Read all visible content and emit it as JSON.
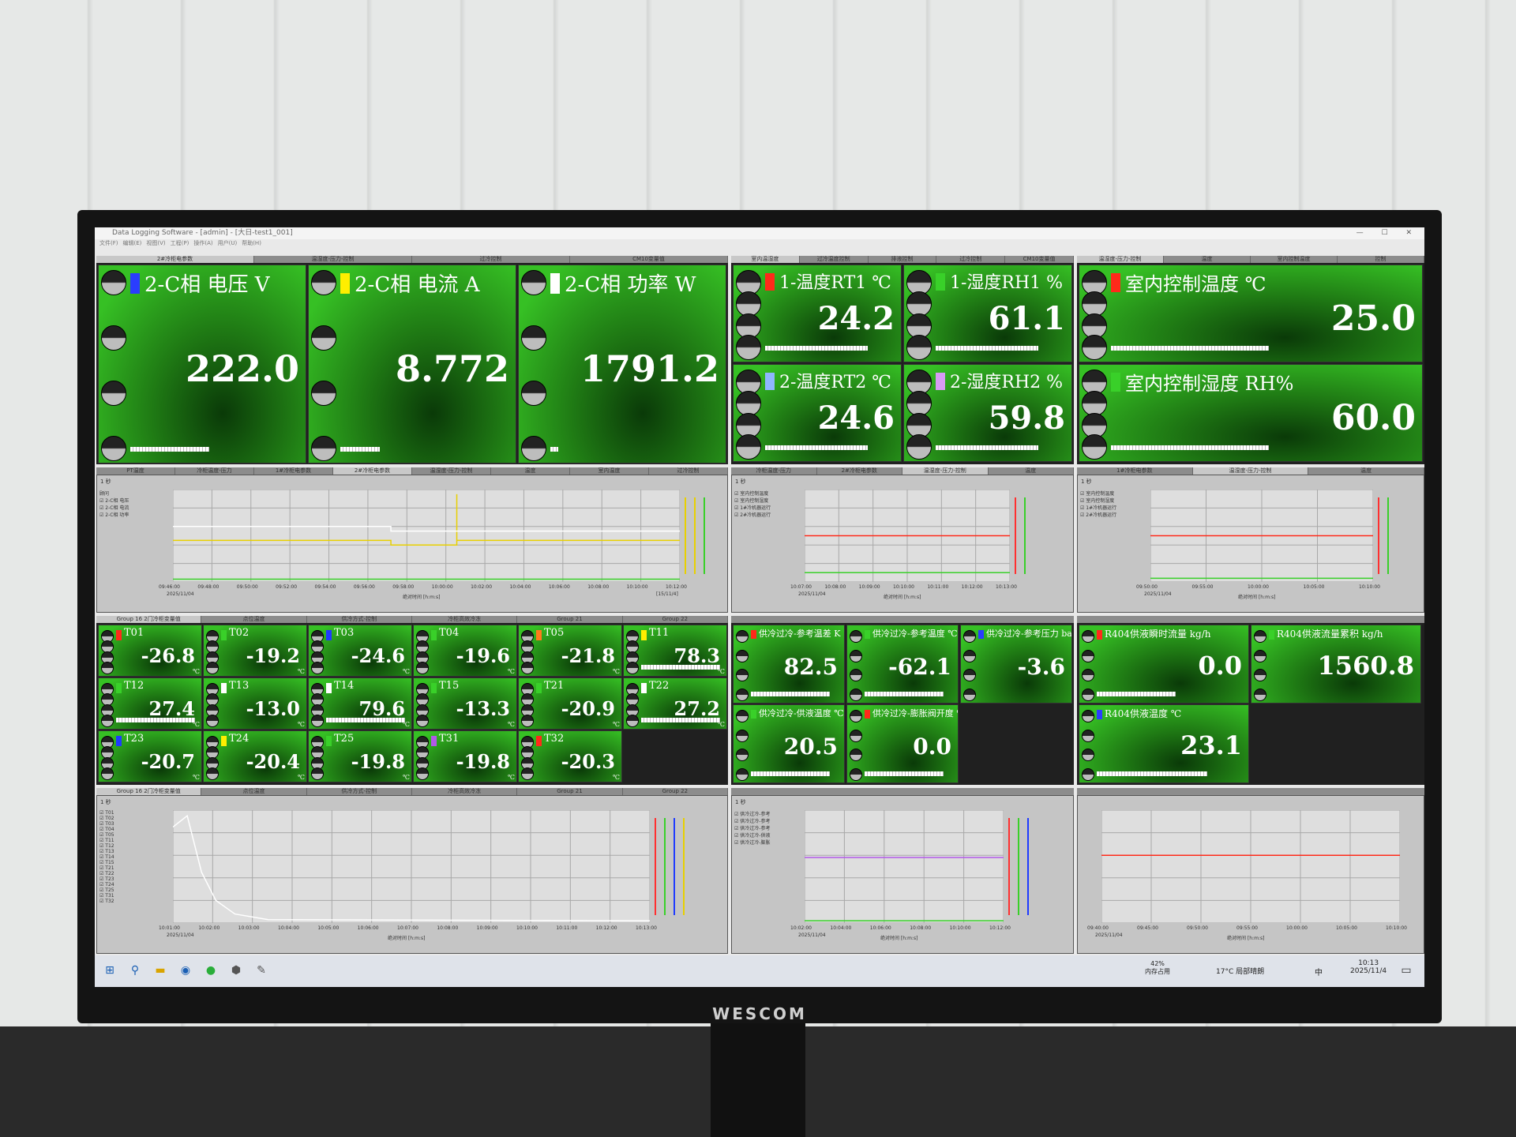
{
  "window": {
    "title": "Data Logging Software - [admin] - [大日-test1_001]",
    "controls": "— ☐ ✕",
    "menu": [
      "文件(F)",
      "编辑(E)",
      "视图(V)",
      "工程(P)",
      "操作(A)",
      "用户(U)",
      "帮助(H)"
    ]
  },
  "top_left_tabs": [
    "2#冷柜电参数",
    "温湿度-压力-控制",
    "过冷控制",
    "CM10变量值"
  ],
  "top_mid_tabs": [
    "室内温湿度",
    "过冷温度控制",
    "排液控制",
    "过冷控制",
    "CM10变量值"
  ],
  "top_right_tabs": [
    "温湿度-压力-控制",
    "温度",
    "室内控制温度",
    "控制"
  ],
  "power_tiles": [
    {
      "label": "2-C相  电压 V",
      "value": "222.0",
      "color": "#2a3dff"
    },
    {
      "label": "2-C相  电流 A",
      "value": "8.772",
      "color": "#ffee00"
    },
    {
      "label": "2-C相  功率 W",
      "value": "1791.2",
      "color": "#ffffff"
    }
  ],
  "env_tiles": [
    {
      "label": "1-温度RT1 ℃",
      "value": "24.2",
      "color": "#ff2a1a"
    },
    {
      "label": "1-湿度RH1  %",
      "value": "61.1",
      "color": "#39d029"
    },
    {
      "label": "2-温度RT2 ℃",
      "value": "24.6",
      "color": "#8fb6ff"
    },
    {
      "label": "2-湿度RH2  %",
      "value": "59.8",
      "color": "#d79bf2"
    }
  ],
  "room_tiles": [
    {
      "label": "室内控制温度 ℃",
      "value": "25.0",
      "color": "#ff2a1a"
    },
    {
      "label": "室内控制湿度 RH%",
      "value": "60.0",
      "color": "#39d029"
    }
  ],
  "chart_tabs_1": [
    "PT温度",
    "冷柜温度-压力",
    "1#冷柜电参数",
    "2#冷柜电参数",
    "温湿度-压力-控制",
    "温度",
    "室内温度",
    "过冷控制"
  ],
  "chart_tabs_2": [
    "冷柜温度-压力",
    "2#冷柜电参数",
    "温湿度-压力-控制",
    "温度"
  ],
  "chart_tabs_3": [
    "1#冷柜电参数",
    "温湿度-压力-控制",
    "温度"
  ],
  "chart1": {
    "interval": "1 秒",
    "legend_header": "顾问",
    "legend": [
      "2-C相  电压",
      "2-C相  电流",
      "2-C相  功率"
    ],
    "x_ticks": [
      "09:46:00",
      "09:48:00",
      "09:50:00",
      "09:52:00",
      "09:54:00",
      "09:56:00",
      "09:58:00",
      "10:00:00",
      "10:02:00",
      "10:04:00",
      "10:06:00",
      "10:08:00",
      "10:10:00",
      "10:12:00"
    ],
    "date": "2025/11/04",
    "xlabel": "绝对时间 [h:m:s]",
    "end_date": "[15/11/4]"
  },
  "chart2": {
    "interval": "1 秒",
    "legend": [
      "室内控制温度",
      "室内控制湿度",
      "1#冷机器运行",
      "2#冷机器运行"
    ],
    "x_ticks": [
      "10:07:00",
      "10:08:00",
      "10:09:00",
      "10:10:00",
      "10:11:00",
      "10:12:00",
      "10:13:00"
    ],
    "date": "2025/11/04",
    "xlabel": "绝对时间 [h:m:s]"
  },
  "chart3": {
    "interval": "1 秒",
    "legend": [
      "室内控制温度",
      "室内控制湿度",
      "1#冷机器运行",
      "2#冷机器运行"
    ],
    "x_ticks": [
      "09:50:00",
      "09:55:00",
      "10:00:00",
      "10:05:00",
      "10:10:00"
    ],
    "date": "2025/11/04",
    "xlabel": "绝对时间 [h:m:s]"
  },
  "group_tabs": [
    "Group 16 2门冷柜变量值",
    "点位温度",
    "供冷方式-控制",
    "冷柜高效冷冻",
    "Group 21",
    "Group 22"
  ],
  "temp_tiles": [
    {
      "label": "T01",
      "value": "-26.8",
      "color": "#ff2a1a"
    },
    {
      "label": "T02",
      "value": "-19.2",
      "color": "#39d029"
    },
    {
      "label": "T03",
      "value": "-24.6",
      "color": "#1f3bff"
    },
    {
      "label": "T04",
      "value": "-19.6",
      "color": "#39d029"
    },
    {
      "label": "T05",
      "value": "-21.8",
      "color": "#ff7a1a"
    },
    {
      "label": "T11",
      "value": "78.3",
      "color": "#ffee00"
    },
    {
      "label": "T12",
      "value": "27.4",
      "color": "#39d029"
    },
    {
      "label": "T13",
      "value": "-13.0",
      "color": "#ffffff"
    },
    {
      "label": "T14",
      "value": "79.6",
      "color": "#ffffff"
    },
    {
      "label": "T15",
      "value": "-13.3",
      "color": "#39d029"
    },
    {
      "label": "T21",
      "value": "-20.9",
      "color": "#39d029"
    },
    {
      "label": "T22",
      "value": "27.2",
      "color": "#ffffff"
    },
    {
      "label": "T23",
      "value": "-20.7",
      "color": "#1f3bff"
    },
    {
      "label": "T24",
      "value": "-20.4",
      "color": "#ffee00"
    },
    {
      "label": "T25",
      "value": "-19.8",
      "color": "#39d029"
    },
    {
      "label": "T31",
      "value": "-19.8",
      "color": "#b259e8"
    },
    {
      "label": "T32",
      "value": "-20.3",
      "color": "#ff2a1a"
    }
  ],
  "temp_unit": "℃",
  "sub_tiles": [
    {
      "label": "供冷过冷-参考温差 K",
      "value": "82.5",
      "color": "#ff2a1a"
    },
    {
      "label": "供冷过冷-参考温度 ℃",
      "value": "-62.1",
      "color": "#39d029"
    },
    {
      "label": "供冷过冷-参考压力 bar",
      "value": "-3.6",
      "color": "#2a3dff"
    },
    {
      "label": "供冷过冷-供液温度 ℃",
      "value": "20.5",
      "color": "#39d029"
    },
    {
      "label": "供冷过冷-膨胀阀开度 %",
      "value": "0.0",
      "color": "#ff2a1a"
    }
  ],
  "r404_tiles": [
    {
      "label": "R404供液瞬时流量 kg/h",
      "value": "0.0",
      "color": "#ff2a1a"
    },
    {
      "label": "R404供液流量累积 kg/h",
      "value": "1560.8",
      "color": "#39d029"
    },
    {
      "label": "R404供液温度 ℃",
      "value": "23.1",
      "color": "#2a3dff"
    }
  ],
  "chart4": {
    "interval": "1 秒",
    "legend": [
      "T01",
      "T02",
      "T03",
      "T04",
      "T05",
      "T11",
      "T12",
      "T13",
      "T14",
      "T15",
      "T21",
      "T22",
      "T23",
      "T24",
      "T25",
      "T31",
      "T32"
    ],
    "x_ticks": [
      "10:01:00",
      "10:02:00",
      "10:03:00",
      "10:04:00",
      "10:05:00",
      "10:06:00",
      "10:07:00",
      "10:08:00",
      "10:09:00",
      "10:10:00",
      "10:11:00",
      "10:12:00",
      "10:13:00"
    ],
    "date": "2025/11/04",
    "xlabel": "绝对时间 [h:m:s]"
  },
  "chart5": {
    "interval": "1 秒",
    "legend": [
      "供冷过冷-参考",
      "供冷过冷-参考",
      "供冷过冷-参考",
      "供冷过冷-供液",
      "供冷过冷-膨胀"
    ],
    "x_ticks": [
      "10:02:00",
      "10:04:00",
      "10:06:00",
      "10:08:00",
      "10:10:00",
      "10:12:00"
    ],
    "date": "2025/11/04",
    "xlabel": "绝对时间 [h:m:s]"
  },
  "chart6": {
    "x_ticks": [
      "09:40:00",
      "09:45:00",
      "09:50:00",
      "09:55:00",
      "10:00:00",
      "10:05:00",
      "10:10:00"
    ],
    "date": "2025/11/04",
    "xlabel": "绝对时间 [h:m:s]"
  },
  "taskbar": {
    "memory_pct": "42%",
    "memory_label": "内存占用",
    "weather": "17°C 局部晴朗",
    "ime": "中",
    "time": "10:13",
    "date": "2025/11/4"
  },
  "monitor_brand": "WESCOM"
}
